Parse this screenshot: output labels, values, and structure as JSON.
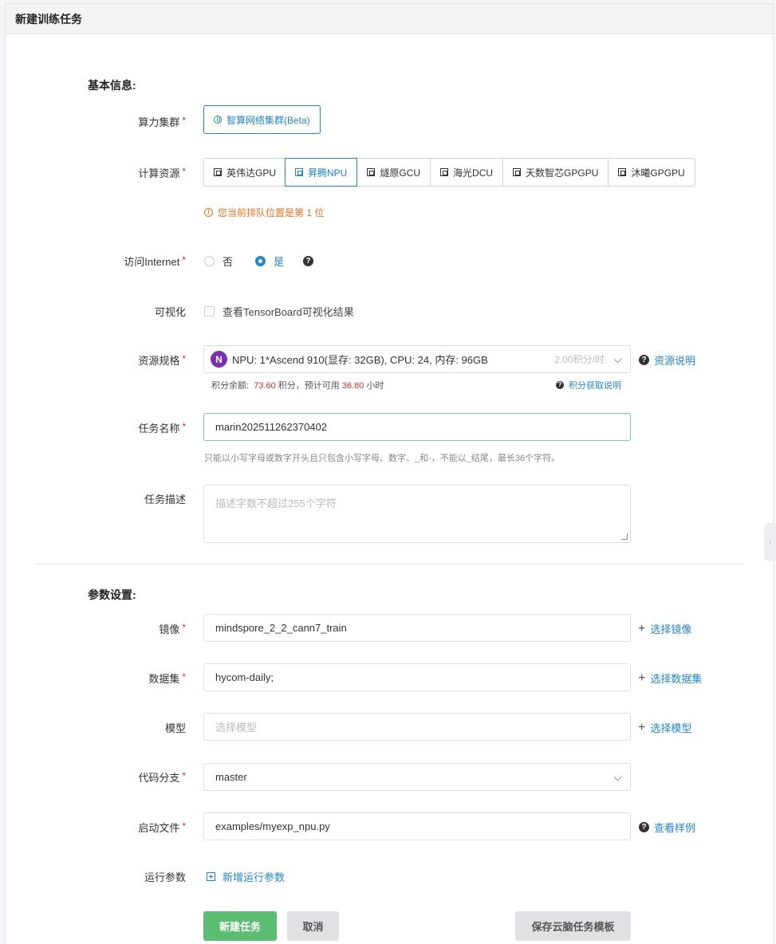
{
  "header": {
    "title": "新建训练任务"
  },
  "basic": {
    "title": "基本信息:",
    "cluster": {
      "label": "算力集群",
      "option": "智算网络集群(Beta)"
    },
    "resource": {
      "label": "计算资源",
      "options": [
        "英伟达GPU",
        "昇腾NPU",
        "燧原GCU",
        "海光DCU",
        "天数智芯GPGPU",
        "沐曦GPGPU"
      ],
      "selected": "昇腾NPU",
      "queue_notice": "您当前排队位置是第 1 位"
    },
    "internet": {
      "label": "访问Internet",
      "no": "否",
      "yes": "是",
      "selected": "是"
    },
    "visual": {
      "label": "可视化",
      "checkbox_label": "查看TensorBoard可视化结果"
    },
    "spec": {
      "label": "资源规格",
      "avatar": "N",
      "value": "NPU: 1*Ascend 910(显存: 32GB), CPU: 24, 内存: 96GB",
      "rate": "2.00积分/时",
      "link": "资源说明",
      "balance_prefix": "积分余额:",
      "balance": "73.60",
      "balance_mid": "积分，预计可用",
      "hours": "36.80",
      "balance_suffix": "小时",
      "points_link": "积分获取说明"
    },
    "name": {
      "label": "任务名称",
      "value": "marin202511262370402",
      "hint": "只能以小写字母或数字开头且只包含小写字母、数字、_和-，不能以_结尾，最长36个字符。"
    },
    "desc": {
      "label": "任务描述",
      "placeholder": "描述字数不超过255个字符"
    }
  },
  "params": {
    "title": "参数设置:",
    "image": {
      "label": "镜像",
      "value": "mindspore_2_2_cann7_train",
      "link": "选择镜像"
    },
    "dataset": {
      "label": "数据集",
      "value": "hycom-daily;",
      "link": "选择数据集"
    },
    "model": {
      "label": "模型",
      "placeholder": "选择模型",
      "link": "选择模型"
    },
    "branch": {
      "label": "代码分支",
      "value": "master"
    },
    "boot": {
      "label": "启动文件",
      "value": "examples/myexp_npu.py",
      "link": "查看样例"
    },
    "run_params": {
      "label": "运行参数",
      "link": "新增运行参数"
    }
  },
  "actions": {
    "create": "新建任务",
    "cancel": "取消",
    "save_template": "保存云脑任务模板"
  },
  "colors": {
    "accent": "#2185d0",
    "primary_green": "#5bbd72",
    "required": "#db2828",
    "warning": "#f2711c",
    "balance": "#db2828"
  }
}
